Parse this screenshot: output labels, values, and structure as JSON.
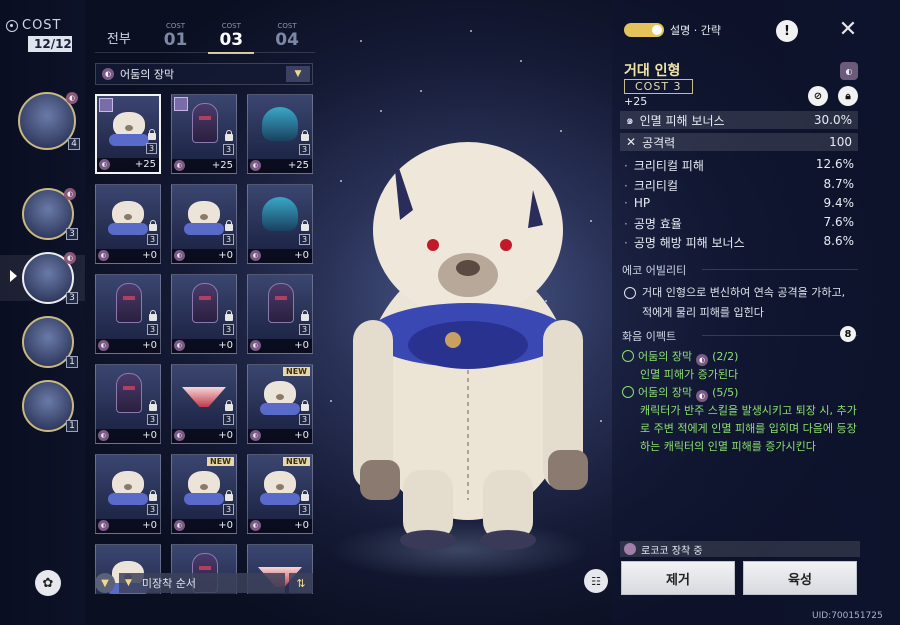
{
  "cost": {
    "label": "COST",
    "value": "12/12"
  },
  "tabs": [
    {
      "label": "전부",
      "sub": ""
    },
    {
      "label": "01",
      "sub": "COST"
    },
    {
      "label": "03",
      "sub": "COST"
    },
    {
      "label": "04",
      "sub": "COST"
    }
  ],
  "set_filter": {
    "label": "어둠의 장막"
  },
  "rail": [
    {
      "count": "4"
    },
    {
      "count": "3"
    },
    {
      "count": "3"
    },
    {
      "count": "1"
    },
    {
      "count": "1"
    }
  ],
  "grid": [
    {
      "level": "+25",
      "cost": "3",
      "type": "bear",
      "equipped": true,
      "selected": true,
      "new": false
    },
    {
      "level": "+25",
      "cost": "3",
      "type": "mask",
      "equipped": true,
      "selected": false,
      "new": false
    },
    {
      "level": "+25",
      "cost": "3",
      "type": "helm",
      "equipped": false,
      "selected": false,
      "new": false
    },
    {
      "level": "+0",
      "cost": "3",
      "type": "bear",
      "equipped": false,
      "selected": false,
      "new": false
    },
    {
      "level": "+0",
      "cost": "3",
      "type": "bear",
      "equipped": false,
      "selected": false,
      "new": false
    },
    {
      "level": "+0",
      "cost": "3",
      "type": "helm",
      "equipped": false,
      "selected": false,
      "new": false
    },
    {
      "level": "+0",
      "cost": "3",
      "type": "mask",
      "equipped": false,
      "selected": false,
      "new": false
    },
    {
      "level": "+0",
      "cost": "3",
      "type": "mask",
      "equipped": false,
      "selected": false,
      "new": false
    },
    {
      "level": "+0",
      "cost": "3",
      "type": "mask",
      "equipped": false,
      "selected": false,
      "new": false
    },
    {
      "level": "+0",
      "cost": "3",
      "type": "mask",
      "equipped": false,
      "selected": false,
      "new": false
    },
    {
      "level": "+0",
      "cost": "3",
      "type": "blade",
      "equipped": false,
      "selected": false,
      "new": false
    },
    {
      "level": "+0",
      "cost": "3",
      "type": "bear",
      "equipped": false,
      "selected": false,
      "new": true
    },
    {
      "level": "+0",
      "cost": "3",
      "type": "bear",
      "equipped": false,
      "selected": false,
      "new": false
    },
    {
      "level": "+0",
      "cost": "3",
      "type": "bear",
      "equipped": false,
      "selected": false,
      "new": true
    },
    {
      "level": "+0",
      "cost": "3",
      "type": "bear",
      "equipped": false,
      "selected": false,
      "new": true
    },
    {
      "level": "",
      "cost": "",
      "type": "bear",
      "equipped": false,
      "selected": false,
      "new": false
    },
    {
      "level": "",
      "cost": "",
      "type": "mask",
      "equipped": false,
      "selected": false,
      "new": false
    },
    {
      "level": "",
      "cost": "",
      "type": "blade",
      "equipped": false,
      "selected": false,
      "new": false
    }
  ],
  "sort": {
    "label": "미장착 순서"
  },
  "toggle": {
    "label": "설명 · 간략"
  },
  "item": {
    "name": "거대 인형",
    "cost": "COST 3",
    "level": "+25",
    "main_stats": [
      {
        "key": "인멸 피해 보너스",
        "value": "30.0%",
        "icon": "swirl-icon"
      },
      {
        "key": "공격력",
        "value": "100",
        "icon": "crossed-swords-icon"
      }
    ],
    "sub_stats": [
      {
        "key": "크리티컬 피해",
        "value": "12.6%"
      },
      {
        "key": "크리티컬",
        "value": "8.7%"
      },
      {
        "key": "HP",
        "value": "9.4%"
      },
      {
        "key": "공명 효율",
        "value": "7.6%"
      },
      {
        "key": "공명 해방 피해 보너스",
        "value": "8.6%"
      }
    ]
  },
  "echo": {
    "title": "에코 어빌리티",
    "text": "거대 인형으로 변신하여 연속 공격을 가하고, 적에게 물리 피해를 입힌다"
  },
  "sonata": {
    "title": "화음 이펙트",
    "count": "8",
    "effects": [
      {
        "name": "어둠의 장막",
        "progress": "(2/2)",
        "desc": "인멸 피해가 증가된다"
      },
      {
        "name": "어둠의 장막",
        "progress": "(5/5)",
        "desc": "캐릭터가 반주 스킬을 발생시키고 퇴장 시, 추가로 주변 적에게 인멸 피해를 입히며 다음에 등장하는 캐릭터의 인멸 피해를 증가시킨다"
      }
    ]
  },
  "equipped_by": "로코코 장착 중",
  "actions": {
    "remove": "제거",
    "upgrade": "육성"
  },
  "uid": "UID:700151725"
}
